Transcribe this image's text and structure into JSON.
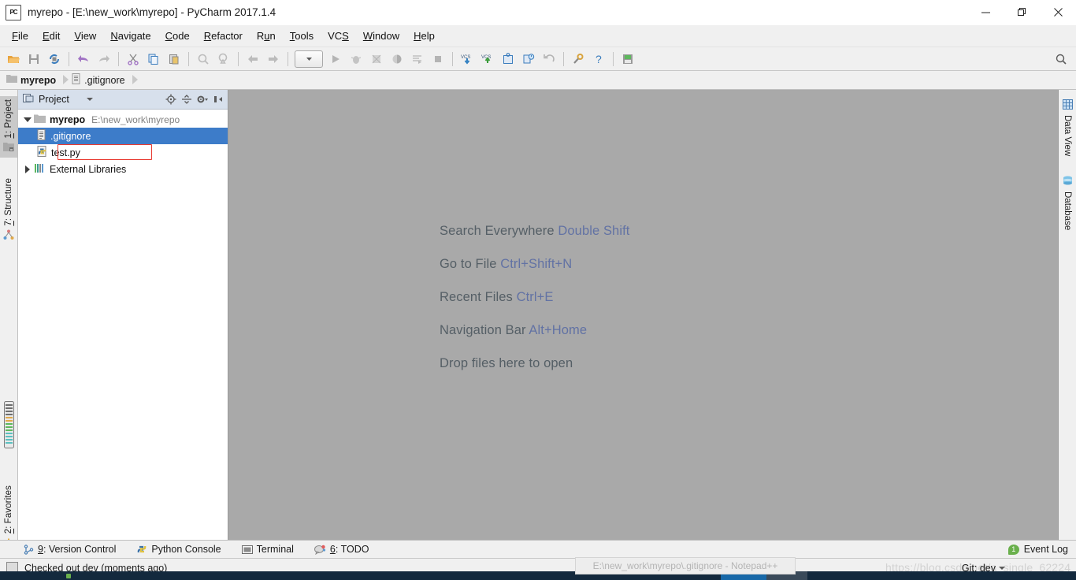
{
  "window": {
    "title": "myrepo - [E:\\new_work\\myrepo] - PyCharm 2017.1.4",
    "app_icon_text": "PC",
    "minimize": "—",
    "restore": "❐",
    "close": "✕"
  },
  "menubar": [
    {
      "pre": "",
      "accel": "F",
      "post": "ile"
    },
    {
      "pre": "",
      "accel": "E",
      "post": "dit"
    },
    {
      "pre": "",
      "accel": "V",
      "post": "iew"
    },
    {
      "pre": "",
      "accel": "N",
      "post": "avigate"
    },
    {
      "pre": "",
      "accel": "C",
      "post": "ode"
    },
    {
      "pre": "",
      "accel": "R",
      "post": "efactor"
    },
    {
      "pre": "R",
      "accel": "u",
      "post": "n"
    },
    {
      "pre": "",
      "accel": "T",
      "post": "ools"
    },
    {
      "pre": "VC",
      "accel": "S",
      "post": ""
    },
    {
      "pre": "",
      "accel": "W",
      "post": "indow"
    },
    {
      "pre": "",
      "accel": "H",
      "post": "elp"
    }
  ],
  "toolbar": {
    "items": [
      {
        "name": "open-folder-icon",
        "title": "Open"
      },
      {
        "name": "save-all-icon",
        "title": "Save All"
      },
      {
        "name": "synchronize-icon",
        "title": "Synchronize"
      },
      {
        "name": "undo-icon",
        "title": "Undo"
      },
      {
        "name": "redo-icon",
        "title": "Redo"
      },
      {
        "name": "cut-icon",
        "title": "Cut"
      },
      {
        "name": "copy-icon",
        "title": "Copy"
      },
      {
        "name": "paste-icon",
        "title": "Paste"
      },
      {
        "name": "find-icon",
        "title": "Find"
      },
      {
        "name": "replace-icon",
        "title": "Replace"
      },
      {
        "name": "back-icon",
        "title": "Back"
      },
      {
        "name": "forward-icon",
        "title": "Forward"
      },
      {
        "name": "run-config-dropdown",
        "title": "Select Run/Debug Configuration"
      },
      {
        "name": "run-icon",
        "title": "Run"
      },
      {
        "name": "debug-icon",
        "title": "Debug"
      },
      {
        "name": "coverage-icon",
        "title": "Run with Coverage"
      },
      {
        "name": "profile-icon",
        "title": "Profile"
      },
      {
        "name": "run-with-console-icon",
        "title": "Run with Console"
      },
      {
        "name": "stop-icon",
        "title": "Stop"
      },
      {
        "name": "vcs-update-icon",
        "title": "Update Project"
      },
      {
        "name": "vcs-commit-icon",
        "title": "Commit"
      },
      {
        "name": "vcs-history-icon",
        "title": "History"
      },
      {
        "name": "vcs-compare-icon",
        "title": "Compare with Latest"
      },
      {
        "name": "vcs-rollback-icon",
        "title": "Rollback"
      },
      {
        "name": "settings-icon",
        "title": "Settings"
      },
      {
        "name": "help-icon",
        "title": "Help"
      },
      {
        "name": "database-save-icon",
        "title": "Data Source"
      }
    ],
    "search_icon": "search-icon"
  },
  "breadcrumb": [
    {
      "label": "myrepo",
      "icon": "folder-icon",
      "bold": true
    },
    {
      "label": ".gitignore",
      "icon": "file-icon",
      "bold": false
    }
  ],
  "left_stripe": [
    {
      "pre": "",
      "accel": "1",
      "post": ": Project",
      "active": true,
      "icon": "project-icon"
    },
    {
      "pre": "",
      "accel": "7",
      "post": ": Structure",
      "active": false,
      "icon": "structure-icon"
    },
    {
      "pre": "",
      "accel": "2",
      "post": ": Favorites",
      "active": false,
      "icon": "star-icon"
    }
  ],
  "right_stripe": [
    {
      "label": "Data View",
      "icon": "grid-icon"
    },
    {
      "label": "Database",
      "icon": "database-icon"
    }
  ],
  "project_panel": {
    "title": "Project",
    "actions": [
      {
        "name": "locate-icon",
        "title": "Scroll from Source"
      },
      {
        "name": "collapse-all-icon",
        "title": "Collapse All"
      },
      {
        "name": "settings-gear-icon",
        "title": "Settings"
      },
      {
        "name": "hide-panel-icon",
        "title": "Hide"
      }
    ],
    "tree": [
      {
        "label": "myrepo",
        "path": "E:\\new_work\\myrepo",
        "icon": "folder-icon",
        "twisty": "open",
        "bold": true,
        "indent": 0,
        "selected": false,
        "annotated": false
      },
      {
        "label": ".gitignore",
        "path": "",
        "icon": "text-file-icon",
        "twisty": "none",
        "bold": false,
        "indent": 1,
        "selected": true,
        "annotated": false
      },
      {
        "label": "test.py",
        "path": "",
        "icon": "python-file-icon",
        "twisty": "none",
        "bold": false,
        "indent": 1,
        "selected": false,
        "annotated": true
      },
      {
        "label": "External Libraries",
        "path": "",
        "icon": "libraries-icon",
        "twisty": "closed",
        "bold": false,
        "indent": 0,
        "selected": false,
        "annotated": false
      }
    ]
  },
  "editor_hints": [
    {
      "text": "Search Everywhere ",
      "key": "Double Shift"
    },
    {
      "text": "Go to File ",
      "key": "Ctrl+Shift+N"
    },
    {
      "text": "Recent Files ",
      "key": "Ctrl+E"
    },
    {
      "text": "Navigation Bar ",
      "key": "Alt+Home"
    },
    {
      "text": "Drop files here to open",
      "key": ""
    }
  ],
  "bottom_tabs": [
    {
      "pre": "",
      "accel": "9",
      "post": ": Version Control",
      "icon": "vcs-branch-icon"
    },
    {
      "pre": "Python Console",
      "accel": "",
      "post": "",
      "icon": "python-icon"
    },
    {
      "pre": "Terminal",
      "accel": "",
      "post": "",
      "icon": "terminal-icon"
    },
    {
      "pre": "",
      "accel": "6",
      "post": ": TODO",
      "icon": "todo-icon"
    }
  ],
  "event_log": {
    "label": "Event Log",
    "count": "1",
    "badge_color": "#6ab04c"
  },
  "statusbar": {
    "message": "Checked out dev (moments ago)",
    "git_label": "Git: dev",
    "watermark": "https://blog.csdn.net/a_single_62224"
  },
  "taskbar_tooltip": "E:\\new_work\\myrepo\\.gitignore - Notepad++",
  "colors": {
    "selection_blue": "#3d7cc9",
    "annotation_red": "#e83b32",
    "editor_gray": "#a9a9a9",
    "hint_key": "#6272a4",
    "chrome_gray": "#f0f0f0"
  }
}
